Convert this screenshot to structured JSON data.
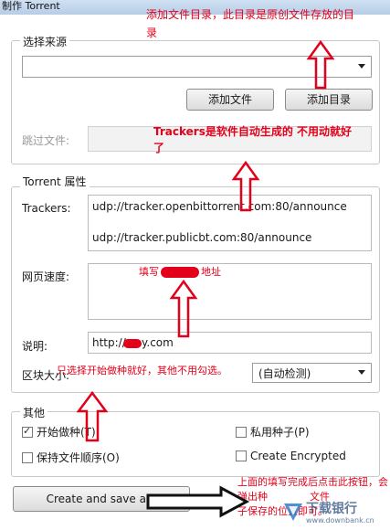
{
  "window": {
    "title": "制作 Torrent"
  },
  "source_group": {
    "legend": "选择来源",
    "path_value": "",
    "add_file_label": "添加文件",
    "add_dir_label": "添加目录",
    "skip_files_label": "跳过文件:"
  },
  "props_group": {
    "legend": "Torrent 属性",
    "trackers_label": "Trackers:",
    "trackers": [
      "udp://tracker.openbittorrent.com:80/announce",
      "udp://tracker.publicbt.com:80/announce"
    ],
    "web_seed_label": "网页速度:",
    "comment_label": "说明:",
    "comment_value": "http://",
    "comment_value_suffix": "y.com",
    "piece_size_label": "区块大小:",
    "piece_size_value": "(自动检测)"
  },
  "other_group": {
    "legend": "其他",
    "start_seeding_label": "开始做种(T)",
    "start_seeding_checked": true,
    "private_label": "私用种子(P)",
    "private_checked": false,
    "preserve_order_label": "保持文件顺序(O)",
    "preserve_order_checked": false,
    "create_encrypted_label": "Create Encrypted",
    "create_encrypted_checked": false
  },
  "create_button_label": "Create and save a...",
  "annotations": {
    "add_dir_note_line1": "添加文件目录，此目录是原创文件存放的目",
    "add_dir_note_line2": "录",
    "trackers_note_line1": "Trackers是软件自动生成的 不用动就好",
    "trackers_note_line2": "了",
    "web_seed_note_prefix": "填写",
    "web_seed_note_suffix": "地址",
    "start_seed_note": "只选择开始做种就好，其他不用勾选。",
    "create_note_line1": "上面的填写完成后点击此按钮，会",
    "create_note_line2": "弹出种",
    "create_note_line3": "文件",
    "create_note_line4": "子保存的位置即可。"
  },
  "watermark": {
    "brand": "下载银行",
    "url": "www.downbank.cn"
  },
  "colors": {
    "annotation": "#e3001b",
    "titlebar": "#b7cde6"
  }
}
